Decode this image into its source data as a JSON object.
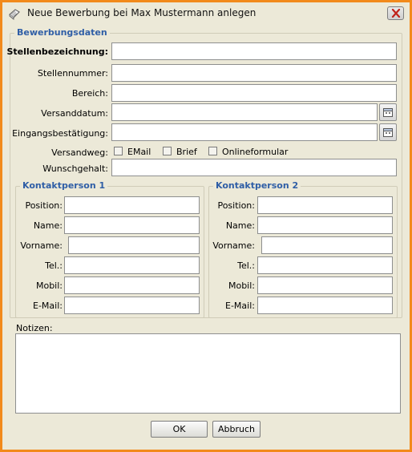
{
  "window": {
    "title": "Neue Bewerbung bei Max Mustermann anlegen",
    "accent_color": "#f28a1b"
  },
  "section": {
    "title": "Bewerbungsdaten",
    "fields": {
      "stellenbezeichnung": {
        "label": "Stellenbezeichnung:",
        "value": ""
      },
      "stellennummer": {
        "label": "Stellennummer:",
        "value": ""
      },
      "bereich": {
        "label": "Bereich:",
        "value": ""
      },
      "versanddatum": {
        "label": "Versanddatum:",
        "value": ""
      },
      "eingangsbestaetigung": {
        "label": "Eingangsbestätigung:",
        "value": ""
      },
      "versandweg": {
        "label": "Versandweg:",
        "options": [
          {
            "label": "EMail",
            "checked": false
          },
          {
            "label": "Brief",
            "checked": false
          },
          {
            "label": "Onlineformular",
            "checked": false
          }
        ]
      },
      "wunschgehalt": {
        "label": "Wunschgehalt:",
        "value": ""
      }
    }
  },
  "contacts": [
    {
      "title": "Kontaktperson 1",
      "fields": [
        {
          "label": "Position:",
          "value": ""
        },
        {
          "label": "Name:",
          "value": ""
        },
        {
          "label": "Vorname:",
          "value": ""
        },
        {
          "label": "Tel.:",
          "value": ""
        },
        {
          "label": "Mobil:",
          "value": ""
        },
        {
          "label": "E-Mail:",
          "value": ""
        }
      ]
    },
    {
      "title": "Kontaktperson 2",
      "fields": [
        {
          "label": "Position:",
          "value": ""
        },
        {
          "label": "Name:",
          "value": ""
        },
        {
          "label": "Vorname:",
          "value": ""
        },
        {
          "label": "Tel.:",
          "value": ""
        },
        {
          "label": "Mobil:",
          "value": ""
        },
        {
          "label": "E-Mail:",
          "value": ""
        }
      ]
    }
  ],
  "notes": {
    "label": "Notizen:",
    "value": ""
  },
  "buttons": {
    "ok": "OK",
    "cancel": "Abbruch"
  },
  "icons": {
    "app": "notepad-icon",
    "close": "close-icon",
    "calendar": "calendar-icon"
  }
}
